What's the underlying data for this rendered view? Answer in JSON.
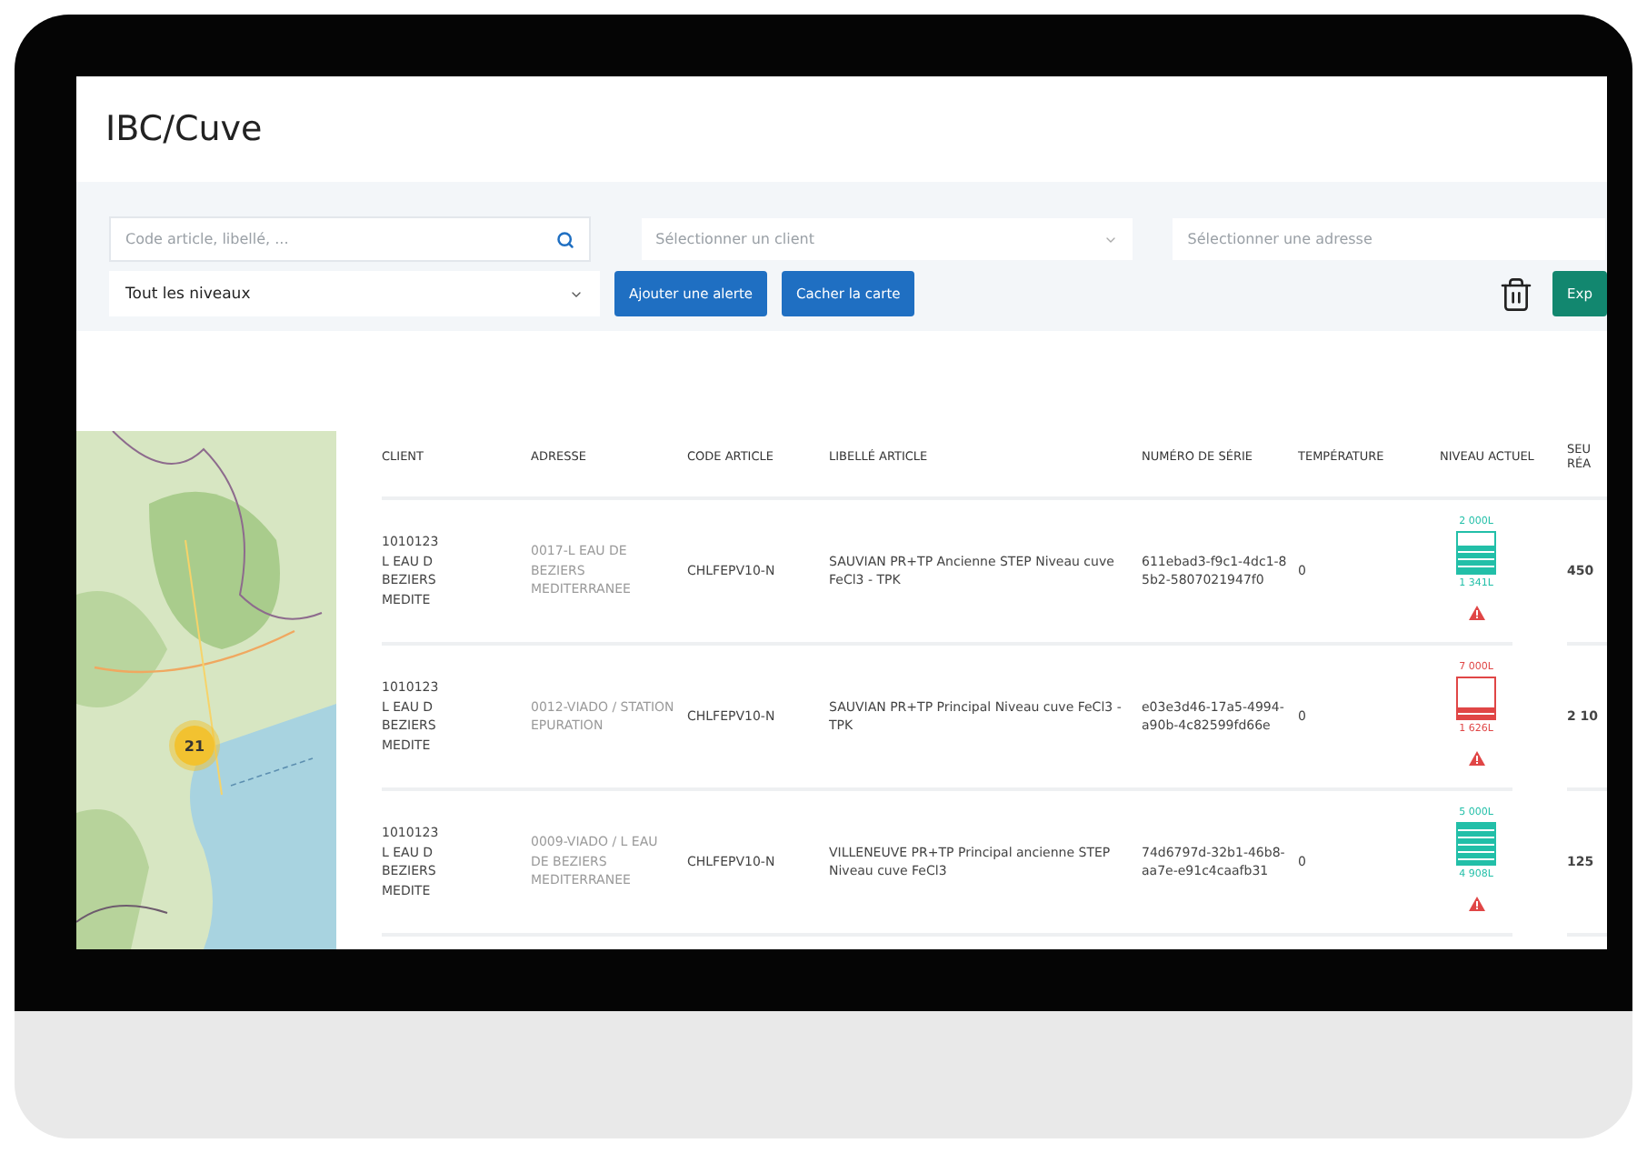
{
  "page": {
    "title": "IBC/Cuve"
  },
  "filters": {
    "search": {
      "placeholder": "Code article, libellé, ..."
    },
    "client_select": {
      "placeholder": "Sélectionner un client"
    },
    "address_select": {
      "placeholder": "Sélectionner une adresse"
    },
    "level_select": {
      "value": "Tout les niveaux"
    },
    "buttons": [
      {
        "label": "Ajouter une alerte",
        "kind": "primary"
      },
      {
        "label": "Cacher la carte",
        "kind": "primary"
      },
      {
        "label": "Exp",
        "kind": "export"
      }
    ]
  },
  "map": {
    "cluster_count": "21"
  },
  "table": {
    "columns": [
      "CLIENT",
      "ADRESSE",
      "CODE ARTICLE",
      "LIBELLÉ ARTICLE",
      "NUMÉRO DE SÉRIE",
      "TEMPÉRATURE",
      "NIVEAU ACTUEL",
      "SEU RÉA"
    ],
    "rows": [
      {
        "client": [
          "1010123",
          "L EAU D",
          "BEZIERS",
          "MEDITE"
        ],
        "address": "0017-L EAU DE BEZIERS MEDITERRANEE",
        "code": "CHLFEPV10-N",
        "label": "SAUVIAN PR+TP Ancienne STEP Niveau cuve FeCl3 - TPK",
        "serial": "611ebad3-f9c1-4dc1-85b2-5807021947f0",
        "temperature": "0",
        "level": {
          "capacity": "2 000L",
          "current": "1 341L",
          "level": 0.67,
          "color": "#22bfa8",
          "alert": true
        },
        "threshold": "450"
      },
      {
        "client": [
          "1010123",
          "L EAU D",
          "BEZIERS",
          "MEDITE"
        ],
        "address": "0012-VIADO / STATION EPURATION",
        "code": "CHLFEPV10-N",
        "label": "SAUVIAN PR+TP Principal Niveau cuve FeCl3 - TPK",
        "serial": "e03e3d46-17a5-4994-a90b-4c82599fd66e",
        "temperature": "0",
        "level": {
          "capacity": "7 000L",
          "current": "1 626L",
          "level": 0.23,
          "color": "#e04646",
          "alert": true
        },
        "threshold": "2 10"
      },
      {
        "client": [
          "1010123",
          "L EAU D",
          "BEZIERS",
          "MEDITE"
        ],
        "address": "0009-VIADO / L EAU DE BEZIERS MEDITERRANEE",
        "code": "CHLFEPV10-N",
        "label": "VILLENEUVE PR+TP Principal ancienne STEP Niveau cuve FeCl3",
        "serial": "74d6797d-32b1-46b8-aa7e-e91c4caafb31",
        "temperature": "0",
        "level": {
          "capacity": "5 000L",
          "current": "4 908L",
          "level": 0.98,
          "color": "#22bfa8",
          "alert": true
        },
        "threshold": "125"
      }
    ]
  }
}
